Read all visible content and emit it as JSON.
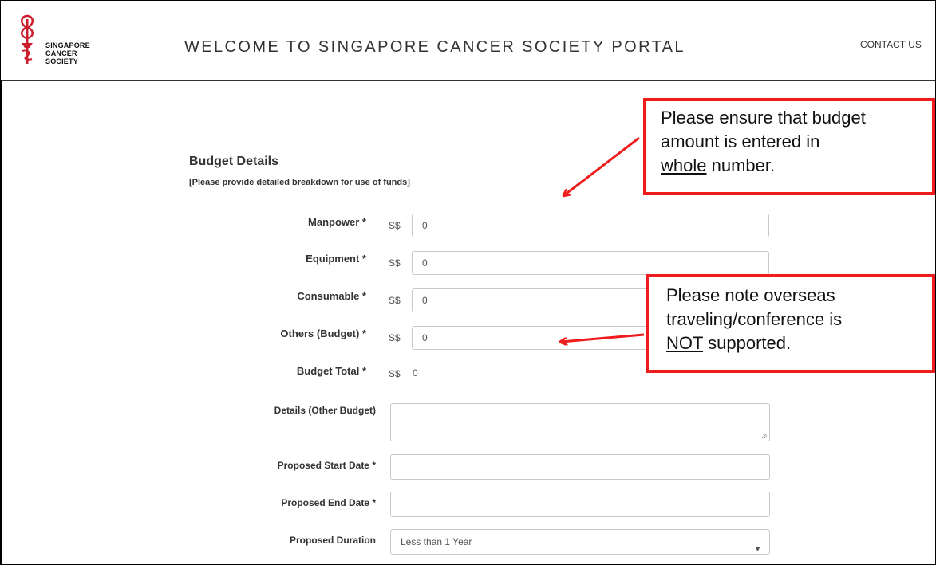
{
  "header": {
    "logo_lines": [
      "SINGAPORE",
      "CANCER",
      "SOCIETY"
    ],
    "title": "WELCOME TO SINGAPORE CANCER SOCIETY PORTAL",
    "contact_label": "CONTACT US"
  },
  "section": {
    "title": "Budget Details",
    "subtitle": "[Please provide detailed breakdown for use of funds]"
  },
  "currency": "S$",
  "fields": {
    "manpower": {
      "label": "Manpower *",
      "value": "0"
    },
    "equipment": {
      "label": "Equipment *",
      "value": "0"
    },
    "consumable": {
      "label": "Consumable *",
      "value": "0"
    },
    "others": {
      "label": "Others (Budget) *",
      "value": "0"
    },
    "budget_total": {
      "label": "Budget Total *",
      "value": "0"
    },
    "details_other": {
      "label": "Details (Other Budget)",
      "value": ""
    },
    "start_date": {
      "label": "Proposed Start Date *",
      "value": ""
    },
    "end_date": {
      "label": "Proposed End Date *",
      "value": ""
    },
    "duration": {
      "label": "Proposed Duration",
      "value": "Less than 1 Year"
    }
  },
  "callouts": {
    "budget": {
      "line1": "Please ensure that budget",
      "line2": "amount is entered in",
      "line3_underlined": "whole",
      "line3_rest": " number."
    },
    "overseas": {
      "line1": "Please note overseas",
      "line2": "traveling/conference is",
      "line3_underlined": "NOT",
      "line3_rest": " supported."
    }
  },
  "colors": {
    "callout_border": "#ee1c1c",
    "arrow": "#ee1c1c",
    "logo": "#cc1f2d"
  }
}
